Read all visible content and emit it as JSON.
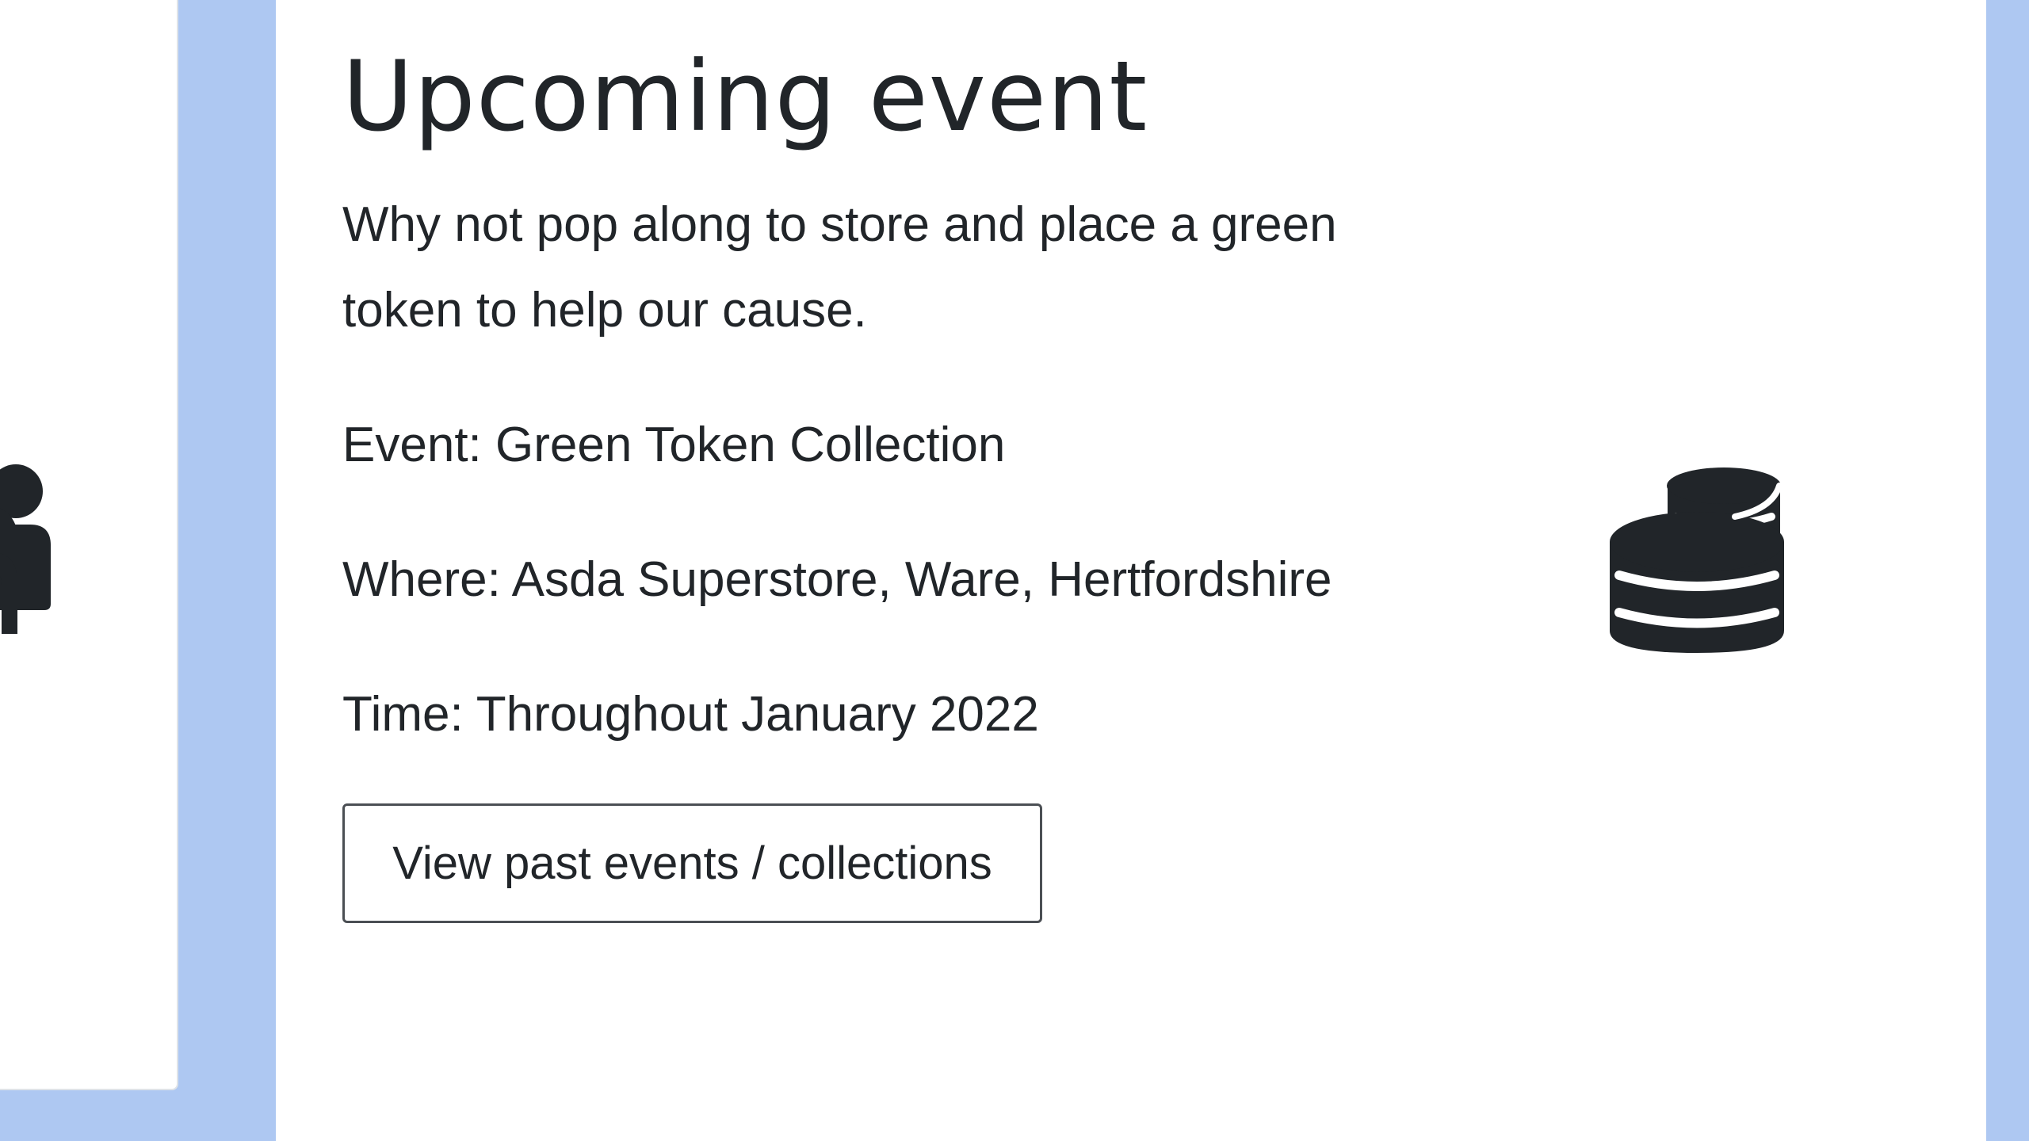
{
  "event": {
    "title": "Upcoming event",
    "intro": "Why not pop along to store and place a green token to help our cause.",
    "event_line": "Event: Green Token Collection",
    "where_line": "Where: Asda Superstore, Ware, Hertfordshire",
    "time_line": "Time: Throughout January 2022",
    "button_label": "View past events / collections"
  },
  "icons": {
    "left_partial": "users-icon",
    "right": "coins-icon"
  },
  "colors": {
    "page_background": "#aec8f2",
    "card_background": "#ffffff",
    "text": "#212529",
    "button_border": "#4b4f54"
  }
}
